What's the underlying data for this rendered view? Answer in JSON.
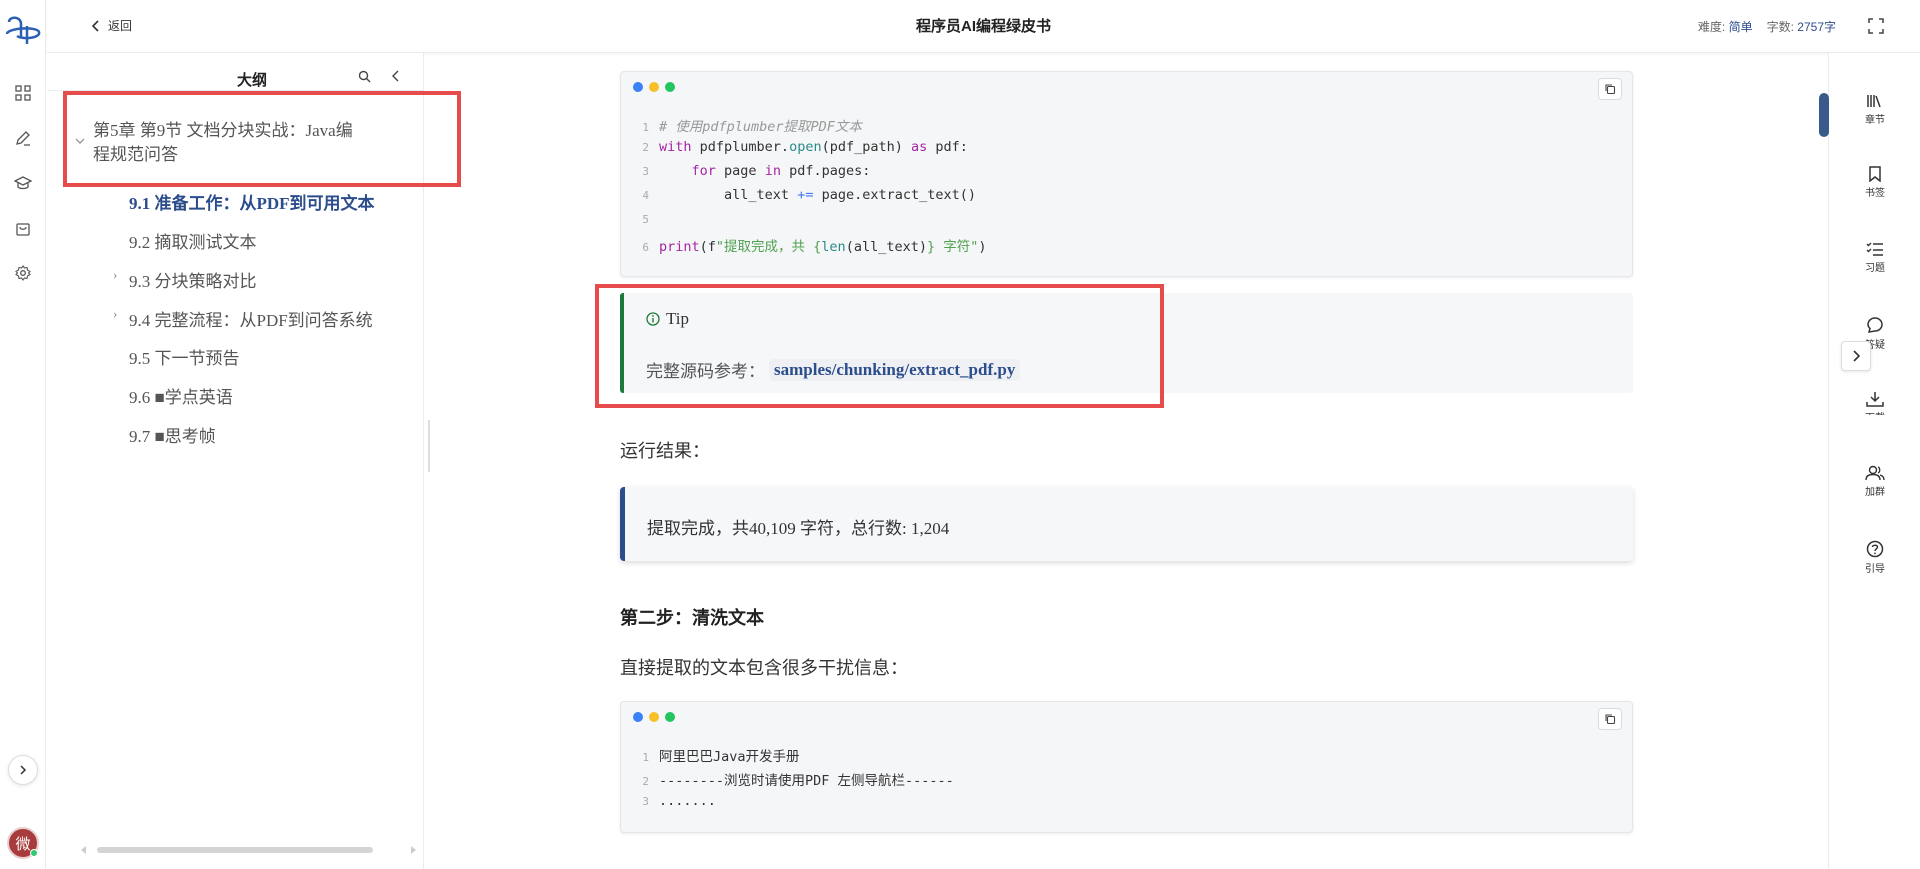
{
  "header": {
    "back_label": "返回",
    "title": "程序员AI编程绿皮书",
    "difficulty_label": "难度:",
    "difficulty_value": "简单",
    "wordcount_label": "字数:",
    "wordcount_value": "2757字"
  },
  "rail": {
    "avatar_text": "微",
    "icons": [
      "grid-icon",
      "edit-icon",
      "graduation-cap-icon",
      "bag-icon",
      "gear-icon"
    ]
  },
  "outline": {
    "title": "大纲",
    "chapter": "第5章 第9节 文档分块实战：Java编程规范问答",
    "sections": [
      {
        "label": "9.1 准备工作：从PDF到可用文本",
        "active": true
      },
      {
        "label": "9.2 摘取测试文本"
      },
      {
        "label": "9.3 分块策略对比",
        "expandable": true
      },
      {
        "label": "9.4 完整流程：从PDF到问答系统",
        "expandable": true
      },
      {
        "label": "9.5 下一节预告"
      },
      {
        "label": "9.6 ■学点英语"
      },
      {
        "label": "9.7 ■思考帧"
      }
    ]
  },
  "code1": {
    "lines": [
      {
        "n": "1",
        "comment": "# 使用pdfplumber提取PDF文本"
      },
      {
        "n": "2",
        "kw1": "with",
        "t1": " pdfplumber.",
        "fn": "open",
        "t2": "(pdf_path) ",
        "kw2": "as",
        "t3": " pdf:"
      },
      {
        "n": "3",
        "indent": "    ",
        "kw1": "for",
        "t1": " page ",
        "kw2": "in",
        "t2": " pdf.pages:"
      },
      {
        "n": "4",
        "indent": "        ",
        "t1": "all_text ",
        "op": "+=",
        "t2": " page.extract_text()"
      },
      {
        "n": "5"
      },
      {
        "n": "6",
        "kw1": "print",
        "t1": "(f",
        "st": "\"提取完成，共 {",
        "fn": "len",
        "t2": "(all_text)",
        "st2": "} 字符\"",
        "t3": ")"
      }
    ]
  },
  "tip": {
    "title": "Tip",
    "text": "完整源码参考：",
    "path": "samples/chunking/extract_pdf.py"
  },
  "run_result_label": "运行结果：",
  "result_text": "提取完成，共40,109 字符，总行数: 1,204",
  "step2_heading": "第二步：清洗文本",
  "step2_text": "直接提取的文本包含很多干扰信息：",
  "code2": {
    "lines": [
      {
        "n": "1",
        "text": "阿里巴巴Java开发手册"
      },
      {
        "n": "2",
        "text": "--------浏览时请使用PDF 左侧导航栏------"
      },
      {
        "n": "3",
        "text": "......."
      }
    ]
  },
  "right_rail": {
    "chapters": "章节",
    "bookmark": "书签",
    "exercises": "习题",
    "qa": "答疑",
    "download": "下载",
    "join_group": "加群",
    "guide": "引导"
  },
  "colors": {
    "accent": "#2b4d8c",
    "tip_border": "#1e7a3a",
    "highlight_box": "#e74c4c"
  }
}
